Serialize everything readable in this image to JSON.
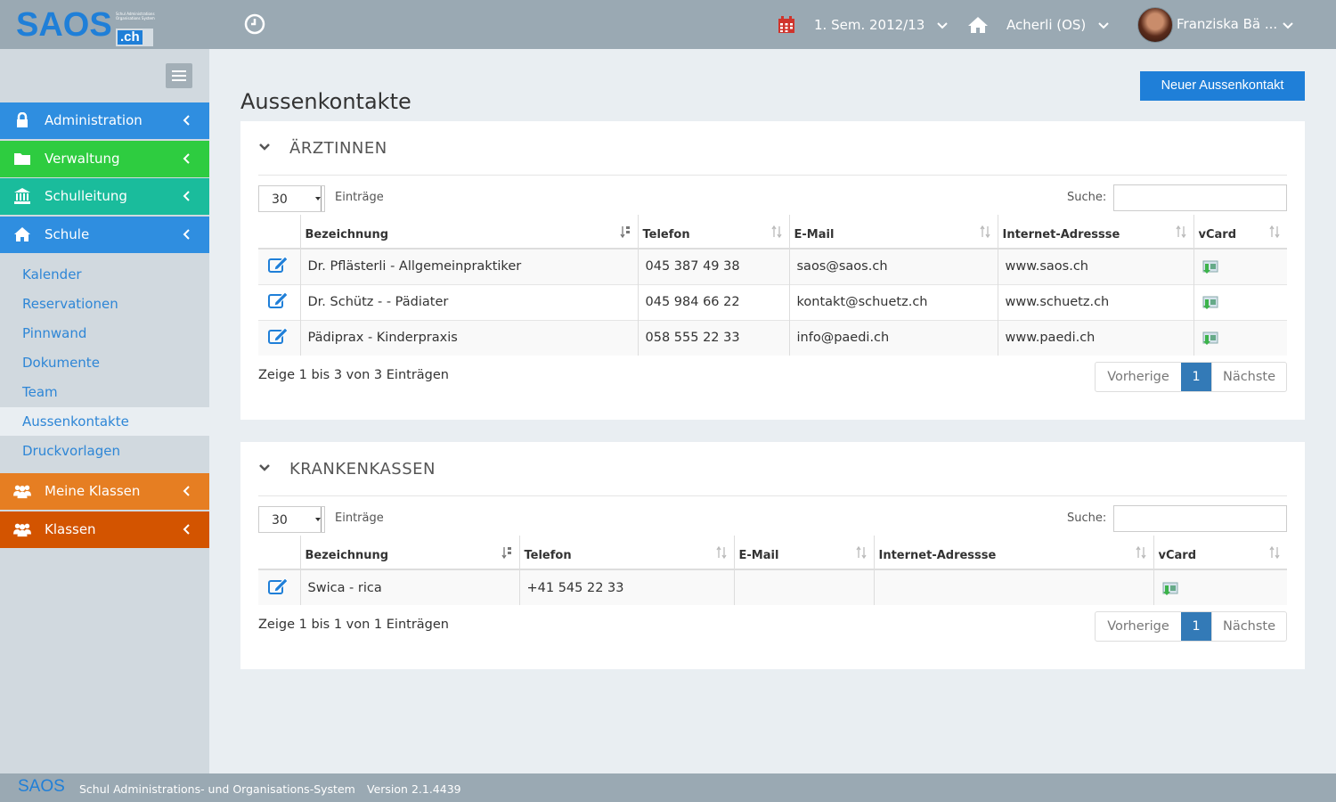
{
  "app": {
    "logo_text": "SAOS",
    "logo_suffix": ".ch",
    "logo_tagline": "Schul Administrations Organisations System"
  },
  "topbar": {
    "semester": "1. Sem. 2012/13",
    "school": "Acherli (OS)",
    "user": "Franziska Bä ..."
  },
  "sidebar": {
    "sections": [
      {
        "label": "Administration",
        "color": "#2f8ee0"
      },
      {
        "label": "Verwaltung",
        "color": "#2ecc40"
      },
      {
        "label": "Schulleitung",
        "color": "#1abc9c"
      },
      {
        "label": "Schule",
        "color": "#2f8ee0"
      }
    ],
    "sub_items": [
      "Kalender",
      "Reservationen",
      "Pinnwand",
      "Dokumente",
      "Team",
      "Aussenkontakte",
      "Druckvorlagen"
    ],
    "bottom_sections": [
      {
        "label": "Meine Klassen",
        "color": "#e67e22"
      },
      {
        "label": "Klassen",
        "color": "#d35400"
      }
    ]
  },
  "main": {
    "title": "Aussenkontakte",
    "new_button": "Neuer Aussenkontakt",
    "panels": [
      {
        "title": "ÄRZTINNEN",
        "page_length": "30",
        "entries_label": "Einträge",
        "search_label": "Suche:",
        "columns": [
          "Bezeichnung",
          "Telefon",
          "E-Mail",
          "Internet-Adressse",
          "vCard"
        ],
        "rows": [
          [
            "Dr. Pflästerli - Allgemeinpraktiker",
            "045 387 49 38",
            "saos@saos.ch",
            "www.saos.ch"
          ],
          [
            "Dr. Schütz - - Pädiater",
            "045 984 66 22",
            "kontakt@schuetz.ch",
            "www.schuetz.ch"
          ],
          [
            "Pädiprax - Kinderpraxis",
            "058 555 22 33",
            "info@paedi.ch",
            "www.paedi.ch"
          ]
        ],
        "info": "Zeige 1 bis 3 von 3 Einträgen",
        "pager": {
          "prev": "Vorherige",
          "current": "1",
          "next": "Nächste"
        }
      },
      {
        "title": "KRANKENKASSEN",
        "page_length": "30",
        "entries_label": "Einträge",
        "search_label": "Suche:",
        "columns": [
          "Bezeichnung",
          "Telefon",
          "E-Mail",
          "Internet-Adressse",
          "vCard"
        ],
        "rows": [
          [
            "Swica - rica",
            "+41 545 22 33",
            "",
            ""
          ]
        ],
        "info": "Zeige 1 bis 1 von 1 Einträgen",
        "pager": {
          "prev": "Vorherige",
          "current": "1",
          "next": "Nächste"
        }
      }
    ]
  },
  "footer": {
    "brand": "SAOS",
    "name": "Schul Administrations- und Organisations-System",
    "version": "Version 2.1.4439"
  },
  "colors": {
    "topbar": "#9aa9b3",
    "accent": "#1f7fd8",
    "calendar_icon": "#d0342c"
  },
  "icons": [
    "clock-icon",
    "calendar-icon",
    "home-icon",
    "chevron-down-icon",
    "lock-icon",
    "folder-icon",
    "bank-icon",
    "house-icon",
    "users-icon",
    "edit-icon",
    "vcard-icon",
    "sort-icon"
  ]
}
